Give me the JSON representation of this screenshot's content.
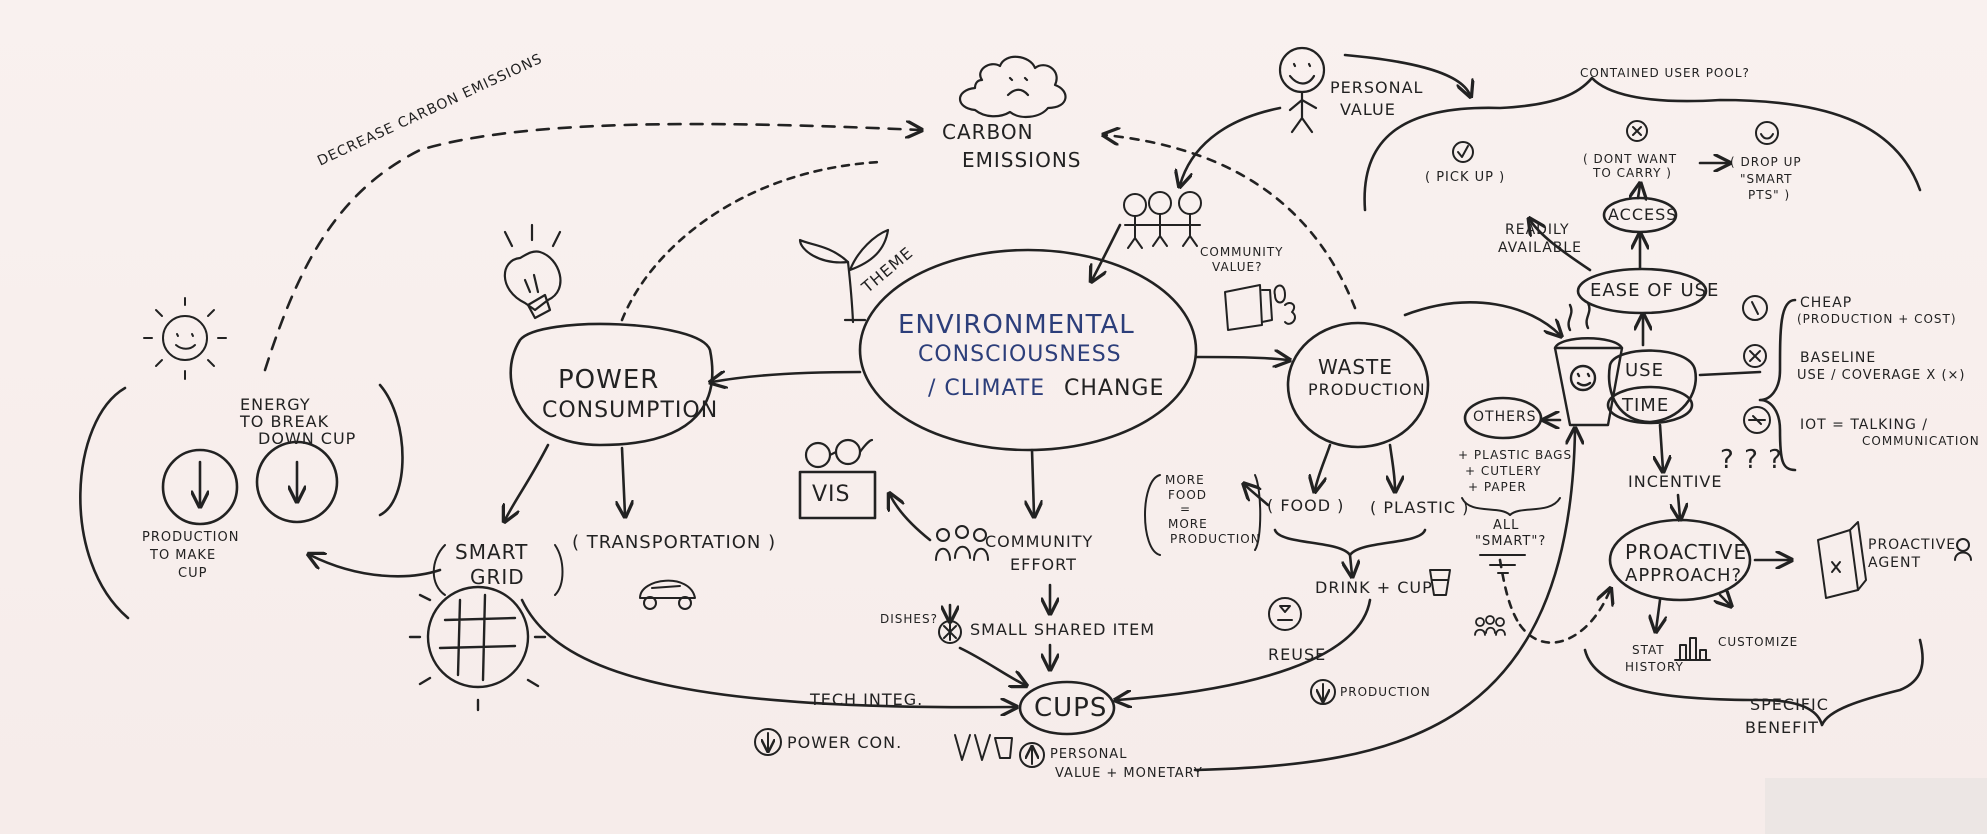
{
  "diagram": {
    "ink_color": "#222222",
    "accent_color": "#2c3e7a",
    "labels": {
      "decrease_carbon": "DECREASE CARBON EMISSIONS",
      "carbon_emissions_1": "CARBON",
      "carbon_emissions_2": "EMISSIONS",
      "personal_value_1": "PERSONAL",
      "personal_value_2": "VALUE",
      "contained_user_pool": "CONTAINED USER POOL?",
      "pick_up": "( PICK UP )",
      "dont_want_1": "( DONT WANT",
      "dont_want_2": "TO CARRY )",
      "drop_up_1": "( DROP UP",
      "drop_up_2": "\"SMART",
      "drop_up_3": "PTS\" )",
      "access": "ACCESS",
      "readily_1": "READILY",
      "readily_2": "AVAILABLE",
      "ease_of_use": "EASE OF USE",
      "community_value_1": "COMMUNITY",
      "community_value_2": "VALUE?",
      "theme": "THEME",
      "env_1": "ENVIRONMENTAL",
      "env_2": "CONSCIOUSNESS",
      "env_3a": "/ CLIMATE",
      "env_3b": "CHANGE",
      "power_1": "POWER",
      "power_2": "CONSUMPTION",
      "waste_1": "WASTE",
      "waste_2": "PRODUCTION",
      "energy_1": "ENERGY",
      "energy_2": "TO BREAK",
      "energy_3": "DOWN CUP",
      "production_make_1": "PRODUCTION",
      "production_make_2": "TO MAKE",
      "production_make_3": "CUP",
      "cheap_1": "CHEAP",
      "cheap_2": "(PRODUCTION + COST)",
      "baseline_1": "BASELINE",
      "baseline_2": "USE / COVERAGE X (×)",
      "iot_1": "IOT = TALKING /",
      "iot_2": "COMMUNICATION",
      "use": "USE",
      "time": "TIME",
      "others": "OTHERS",
      "others_list_1": "+ PLASTIC BAGS",
      "others_list_2": "+ CUTLERY",
      "others_list_3": "+ PAPER",
      "all_smart_1": "ALL",
      "all_smart_2": "\"SMART\"?",
      "incentive": "INCENTIVE",
      "qmarks": "? ? ?",
      "more_food_1": "MORE",
      "more_food_2": "FOOD",
      "more_food_3": "=",
      "more_food_4": "MORE",
      "more_food_5": "PRODUCTION",
      "food": "( FOOD )",
      "plastic": "( PLASTIC )",
      "drink_cup": "DRINK + CUP",
      "reuse": "REUSE",
      "production_small": "PRODUCTION",
      "vis": "VIS",
      "community_effort_1": "COMMUNITY",
      "community_effort_2": "EFFORT",
      "dishes": "DISHES?",
      "small_shared": "SMALL SHARED ITEM",
      "smart_grid_1": "SMART",
      "smart_grid_2": "GRID",
      "transportation": "( TRANSPORTATION )",
      "tech_integ": "TECH INTEG.",
      "cups": "CUPS",
      "power_con": "POWER CON.",
      "personal_monetary_1": "PERSONAL",
      "personal_monetary_2": "VALUE + MONETARY",
      "proactive_1": "PROACTIVE",
      "proactive_2": "APPROACH?",
      "proactive_agent_1": "PROACTIVE",
      "proactive_agent_2": "AGENT",
      "stat_1": "STAT",
      "stat_2": "HISTORY",
      "customize": "CUSTOMIZE",
      "specific_1": "SPECIFIC",
      "specific_2": "BENEFIT"
    }
  }
}
